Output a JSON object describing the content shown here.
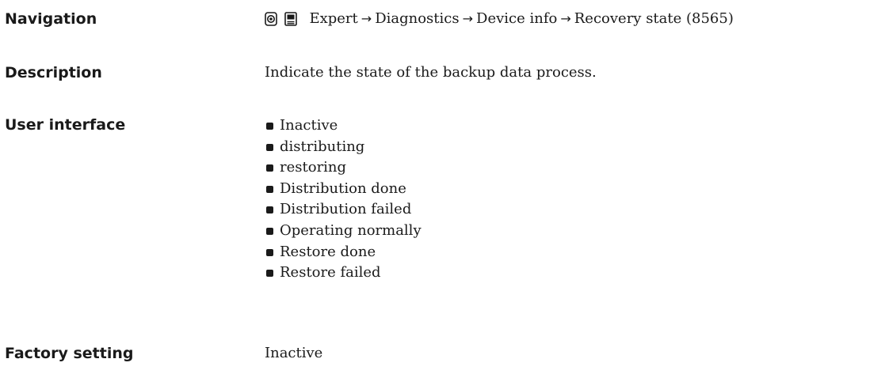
{
  "navigation": {
    "label": "Navigation",
    "icons": [
      "operating-menu-icon",
      "display-module-icon"
    ],
    "path": [
      "Expert",
      "Diagnostics",
      "Device info",
      "Recovery state (8565)"
    ],
    "separator": "→"
  },
  "description": {
    "label": "Description",
    "text": "Indicate the state of the backup data process."
  },
  "user_interface": {
    "label": "User interface",
    "options": [
      "Inactive",
      "distributing",
      "restoring",
      "Distribution done",
      "Distribution failed",
      "Operating normally",
      "Restore done",
      "Restore failed"
    ]
  },
  "factory_setting": {
    "label": "Factory setting",
    "value": "Inactive"
  }
}
